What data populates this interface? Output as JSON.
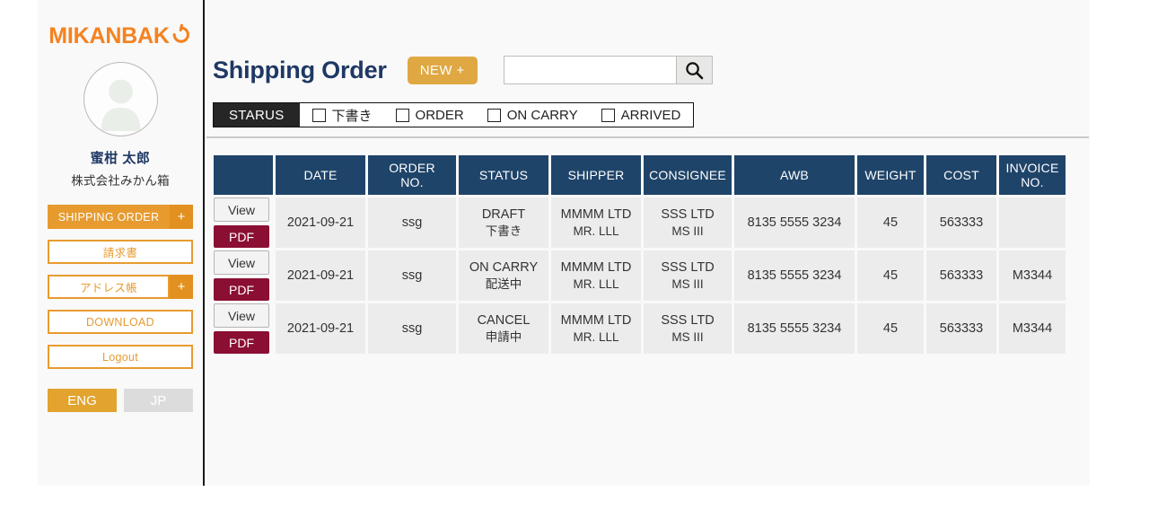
{
  "brand": {
    "name": "MIKANBAK",
    "icon": "power-circle-icon"
  },
  "sidebar": {
    "avatar_icon": "user-avatar-icon",
    "user_name": "蜜柑 太郎",
    "company": "株式会社みかん箱",
    "nav": [
      {
        "label": "SHIPPING ORDER",
        "style": "solid",
        "plus": "+"
      },
      {
        "label": "請求書",
        "style": "outline",
        "plus": null
      },
      {
        "label": "アドレス帳",
        "style": "outline",
        "plus": "+"
      },
      {
        "label": "DOWNLOAD",
        "style": "outline",
        "plus": null
      },
      {
        "label": "Logout",
        "style": "outline",
        "plus": null
      }
    ],
    "lang": {
      "eng": "ENG",
      "jp": "JP",
      "active": "ENG"
    }
  },
  "header": {
    "title": "Shipping Order",
    "new_label": "NEW +",
    "search_value": "",
    "search_placeholder": "",
    "search_icon": "magnifier-icon"
  },
  "filter": {
    "label": "STARUS",
    "options": [
      {
        "label": "下書き",
        "checked": false
      },
      {
        "label": "ORDER",
        "checked": false
      },
      {
        "label": "ON CARRY",
        "checked": false
      },
      {
        "label": "ARRIVED",
        "checked": false
      }
    ]
  },
  "table": {
    "columns": [
      {
        "key": "actions",
        "label": ""
      },
      {
        "key": "date",
        "label": "DATE"
      },
      {
        "key": "order_no",
        "label": "ORDER NO.",
        "line1": "ORDER",
        "line2": "NO."
      },
      {
        "key": "status",
        "label": "STATUS"
      },
      {
        "key": "shipper",
        "label": "SHIPPER"
      },
      {
        "key": "consignee",
        "label": "CONSIGNEE"
      },
      {
        "key": "awb",
        "label": "AWB"
      },
      {
        "key": "weight",
        "label": "WEIGHT"
      },
      {
        "key": "cost",
        "label": "COST"
      },
      {
        "key": "invoice_no",
        "label": "INVOICE NO.",
        "line1": "INVOICE",
        "line2": "NO."
      }
    ],
    "row_actions": {
      "view": "View",
      "pdf": "PDF"
    },
    "rows": [
      {
        "date": "2021-09-21",
        "order_no": "ssg",
        "status_en": "DRAFT",
        "status_jp": "下書き",
        "status_state": "draft",
        "shipper_1": "MMMM LTD",
        "shipper_2": "MR. LLL",
        "consignee_1": "SSS LTD",
        "consignee_2": "MS III",
        "awb": "8135 5555 3234",
        "weight": "45",
        "cost": "563333",
        "invoice_no": ""
      },
      {
        "date": "2021-09-21",
        "order_no": "ssg",
        "status_en": "ON CARRY",
        "status_jp": "配送中",
        "status_state": "on-carry",
        "shipper_1": "MMMM LTD",
        "shipper_2": "MR. LLL",
        "consignee_1": "SSS LTD",
        "consignee_2": "MS III",
        "awb": "8135 5555 3234",
        "weight": "45",
        "cost": "563333",
        "invoice_no": "M3344"
      },
      {
        "date": "2021-09-21",
        "order_no": "ssg",
        "status_en": "CANCEL",
        "status_jp": "申請中",
        "status_state": "cancel",
        "shipper_1": "MMMM LTD",
        "shipper_2": "MR. LLL",
        "consignee_1": "SSS LTD",
        "consignee_2": "MS III",
        "awb": "8135 5555 3234",
        "weight": "45",
        "cost": "563333",
        "invoice_no": "M3344"
      }
    ]
  },
  "colors": {
    "brand_orange": "#F58220",
    "accent_gold": "#E79B2F",
    "header_navy": "#1F4469",
    "title_navy": "#1F3864",
    "pdf_maroon": "#8B0E33",
    "cancel_red": "#ED2024",
    "filter_dark": "#262626"
  }
}
